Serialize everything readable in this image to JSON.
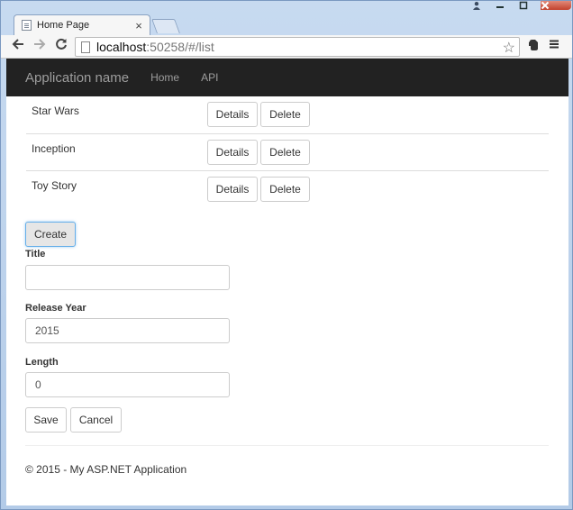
{
  "browser": {
    "tab_title": "Home Page",
    "tab_close": "×",
    "url_host": "localhost",
    "url_rest": ":50258/#/list"
  },
  "navbar": {
    "brand": "Application name",
    "links": [
      "Home",
      "API"
    ]
  },
  "movies": [
    {
      "title": "Star Wars",
      "details": "Details",
      "delete": "Delete"
    },
    {
      "title": "Inception",
      "details": "Details",
      "delete": "Delete"
    },
    {
      "title": "Toy Story",
      "details": "Details",
      "delete": "Delete"
    }
  ],
  "form": {
    "create_label": "Create",
    "title_label": "Title",
    "title_value": "",
    "year_label": "Release Year",
    "year_value": "2015",
    "length_label": "Length",
    "length_value": "0",
    "save_label": "Save",
    "cancel_label": "Cancel"
  },
  "footer": {
    "text": "© 2015 - My ASP.NET Application"
  }
}
